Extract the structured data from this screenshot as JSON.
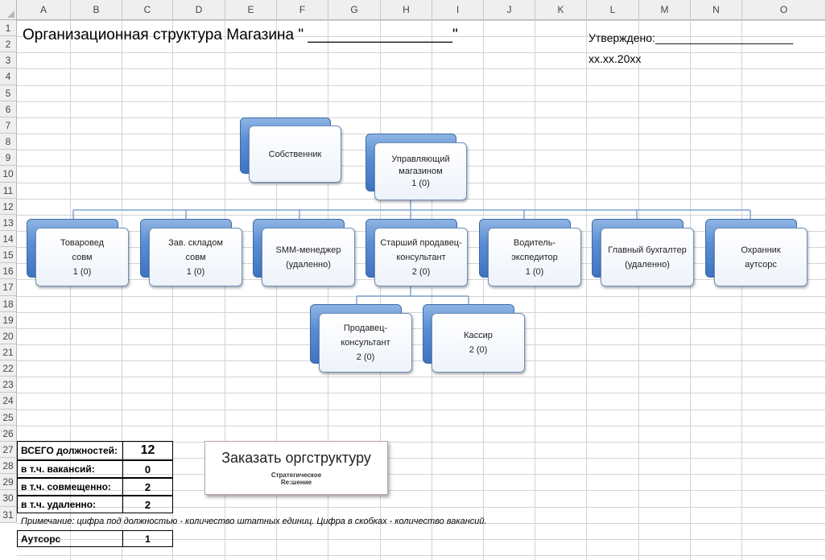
{
  "columns": [
    "A",
    "B",
    "C",
    "D",
    "E",
    "F",
    "G",
    "H",
    "I",
    "J",
    "K",
    "L",
    "M",
    "N",
    "O"
  ],
  "rows": [
    "1",
    "2",
    "3",
    "4",
    "5",
    "6",
    "7",
    "8",
    "9",
    "10",
    "11",
    "12",
    "13",
    "14",
    "15",
    "16",
    "17",
    "18",
    "19",
    "20",
    "21",
    "22",
    "23",
    "24",
    "25",
    "26",
    "27",
    "28",
    "29",
    "30",
    "31"
  ],
  "sheet": {
    "title": "Организационная структура Магазина \" _________________\"",
    "approved_label": "Утверждено:______________________",
    "approved_date": "xx.xx.20xx"
  },
  "org": {
    "owner": {
      "line1": "Собственник"
    },
    "manager": {
      "line1": "Управляющий",
      "line2": "магазином",
      "line3": "1 (0)"
    },
    "level2": [
      {
        "line1": "Товаровед",
        "line2": "совм",
        "line3": "1 (0)"
      },
      {
        "line1": "Зав. складом",
        "line2": "совм",
        "line3": "1 (0)"
      },
      {
        "line1": "SMM-менеджер",
        "line2": "(удаленно)",
        "line3": ""
      },
      {
        "line1": "Старший продавец-",
        "line2": "консультант",
        "line3": "2 (0)"
      },
      {
        "line1": "Водитель-",
        "line2": "экспедитор",
        "line3": "1 (0)"
      },
      {
        "line1": "Главный бухгалтер",
        "line2": "(удаленно)",
        "line3": ""
      },
      {
        "line1": "Охранник",
        "line2": "аутсорс",
        "line3": ""
      }
    ],
    "level3": [
      {
        "line1": "Продавец-",
        "line2": "консультант",
        "line3": "2 (0)"
      },
      {
        "line1": "Кассир",
        "line2": "2 (0)",
        "line3": ""
      }
    ]
  },
  "summary": [
    {
      "label": "ВСЕГО должностей:",
      "value": "12"
    },
    {
      "label": "в т.ч. вакансий:",
      "value": "0"
    },
    {
      "label": "в т.ч. совмещенно:",
      "value": "2"
    },
    {
      "label": "в т.ч. удаленно:",
      "value": "2"
    }
  ],
  "note": "Примечание: цифра под должностью - количество штатных единиц. Цифра в скобках - количество вакансий.",
  "outsource": {
    "label": "Аутсорс",
    "value": "1"
  },
  "order_button": {
    "label": "Заказать оргструктуру",
    "brand_line1": "Стратегическое",
    "brand_line2": "Re:шение"
  },
  "colors": {
    "box_accent": "#5b8fd4",
    "grid": "#d4d4d4",
    "header_bg": "#efefef"
  }
}
